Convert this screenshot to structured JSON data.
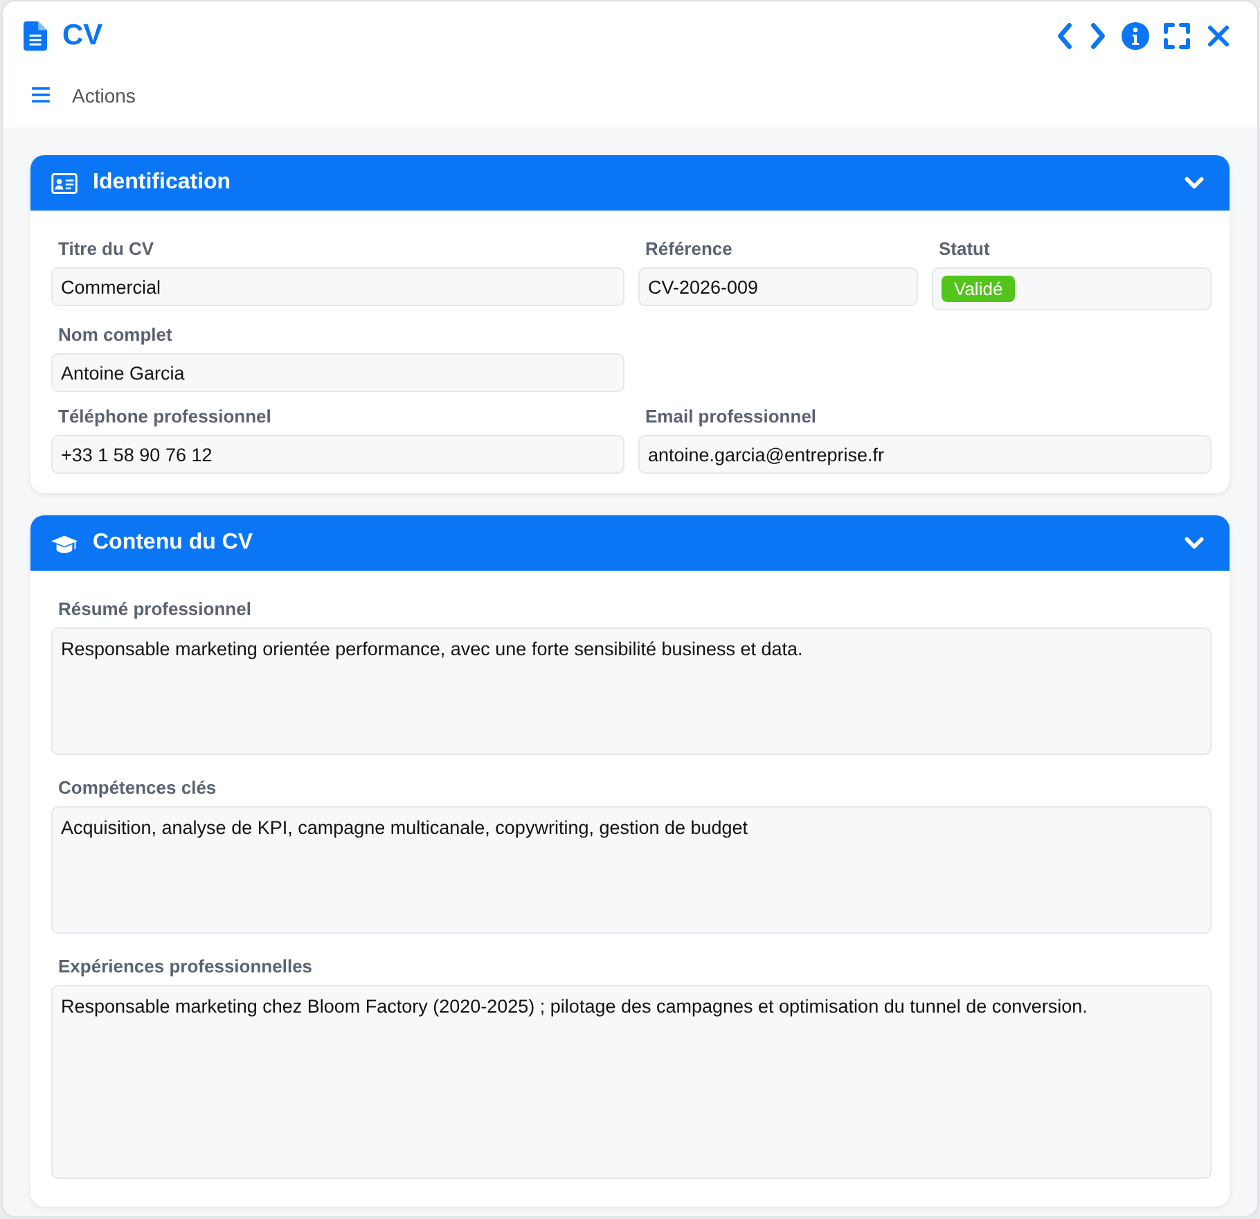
{
  "window": {
    "title": "CV"
  },
  "toolbar": {
    "actions_label": "Actions"
  },
  "sections": [
    {
      "title": "Identification",
      "expanded": true,
      "fields": [
        {
          "kind": "text",
          "label": "Titre du CV",
          "value": "Commercial"
        },
        {
          "kind": "text",
          "label": "Référence",
          "value": "CV-2026-009"
        },
        {
          "kind": "badge",
          "label": "Statut",
          "value": "Validé",
          "color": "#52c41a"
        },
        {
          "kind": "text",
          "label": "Nom complet",
          "value": "Antoine Garcia"
        },
        {
          "kind": "text",
          "label": "Téléphone professionnel",
          "value": "+33 1 58 90 76 12"
        },
        {
          "kind": "text",
          "label": "Email professionnel",
          "value": "antoine.garcia@entreprise.fr"
        }
      ]
    },
    {
      "title": "Contenu du CV",
      "expanded": true,
      "fields": [
        {
          "kind": "textarea",
          "label": "Résumé professionnel",
          "value": "Responsable marketing orientée performance, avec une forte sensibilité business et data."
        },
        {
          "kind": "textarea",
          "label": "Compétences clés",
          "value": "Acquisition, analyse de KPI, campagne multicanale, copywriting, gestion de budget"
        },
        {
          "kind": "textarea",
          "label": "Expériences professionnelles",
          "value": "Responsable marketing chez Bloom Factory (2020-2025) ; pilotage des campagnes et optimisation du tunnel de conversion."
        }
      ]
    }
  ]
}
